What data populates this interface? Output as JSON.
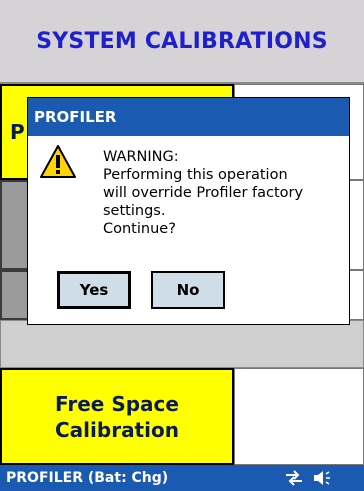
{
  "header": {
    "title": "SYSTEM CALIBRATIONS"
  },
  "tiles": {
    "top_left_partial_letter": "P",
    "free_space_line1": "Free Space",
    "free_space_line2": "Calibration"
  },
  "dialog": {
    "title": "PROFILER",
    "icon": "warning-icon",
    "message": "WARNING:\nPerforming this operation\nwill override Profiler factory\nsettings.\nContinue?",
    "yes_label": "Yes",
    "no_label": "No"
  },
  "taskbar": {
    "label": "PROFILER (Bat: Chg)",
    "icons": [
      "connectivity-icon",
      "volume-icon"
    ]
  },
  "colors": {
    "title_blue": "#1f1fcc",
    "titlebar_blue": "#1a5ab0",
    "tile_yellow": "#ffff00",
    "button_bg": "#cfdde9"
  }
}
